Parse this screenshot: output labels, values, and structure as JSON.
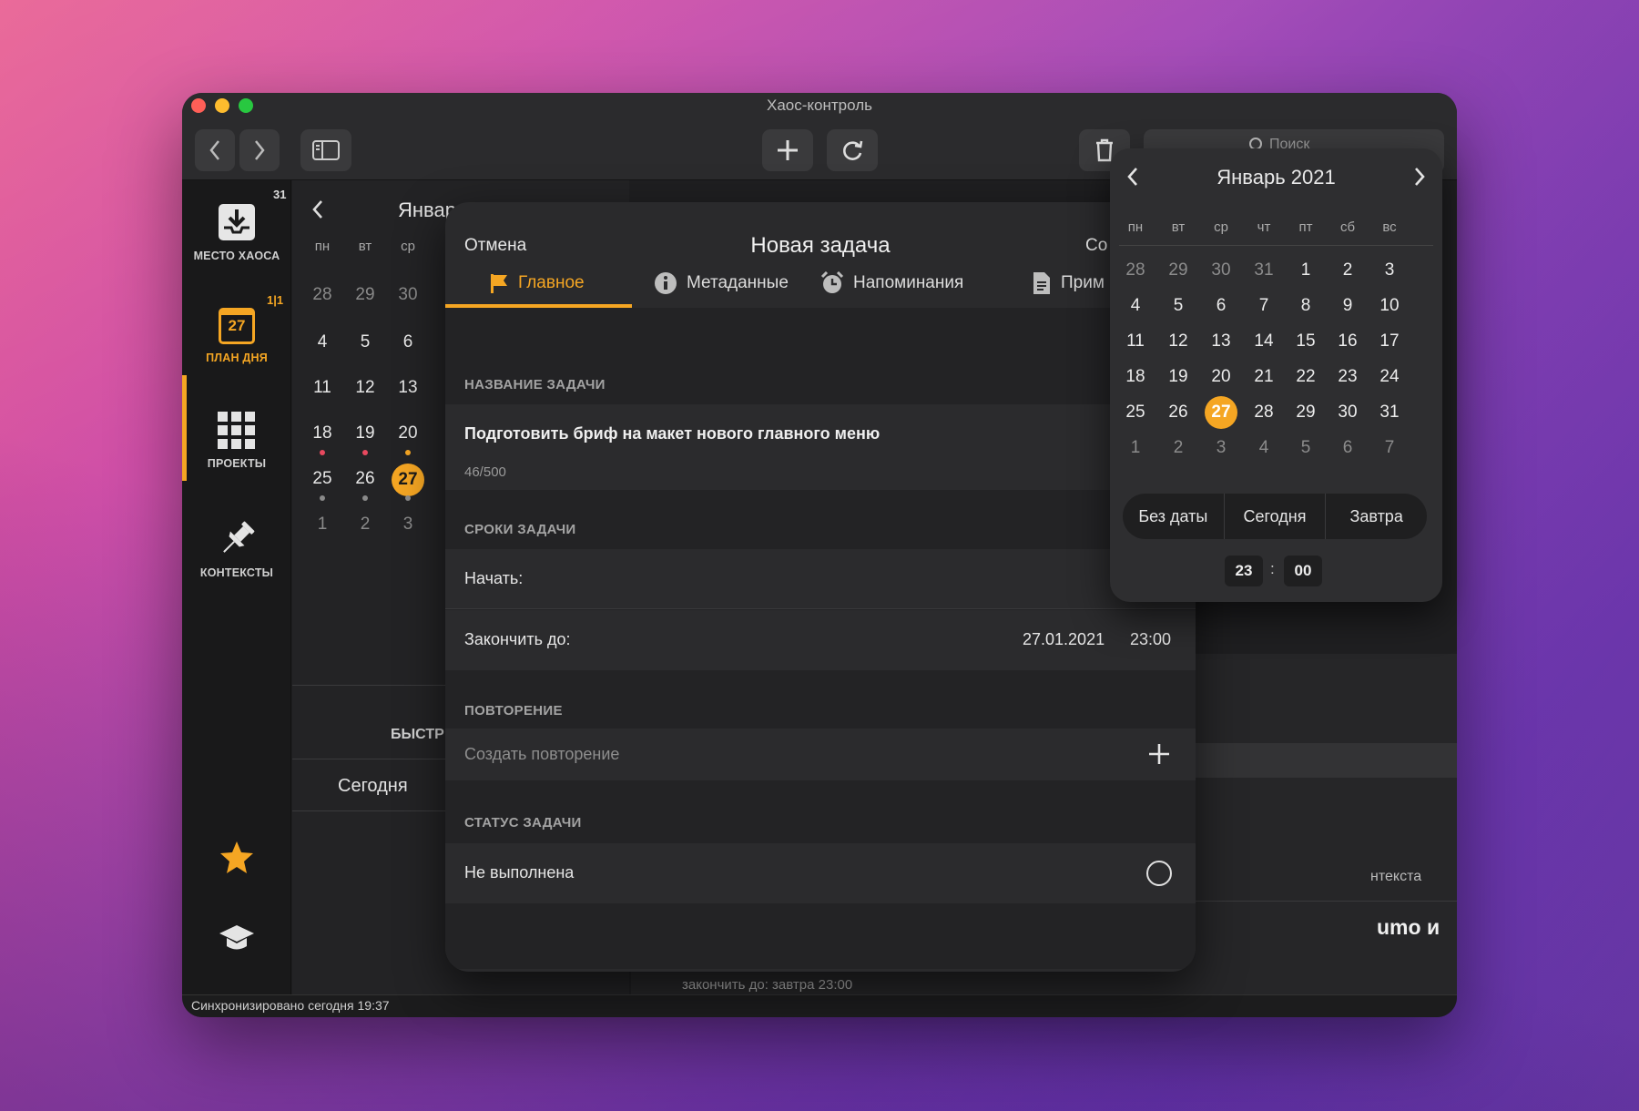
{
  "window": {
    "title": "Хаос-контроль",
    "status": "Синхронизировано сегодня 19:37"
  },
  "toolbar": {
    "search_placeholder": "Поиск"
  },
  "sidebar": {
    "inbox": {
      "label": "МЕСТО ХАОСА",
      "badge": "31"
    },
    "dayplan": {
      "label": "ПЛАН ДНЯ",
      "badge": "1|1",
      "icon_day": "27"
    },
    "projects": {
      "label": "ПРОЕКТЫ"
    },
    "contexts": {
      "label": "КОНТЕКСТЫ"
    }
  },
  "calendar_panel": {
    "month": "Январ",
    "weekdays": [
      "пн",
      "вт",
      "ср"
    ],
    "rows": [
      [
        "28",
        "29",
        "30"
      ],
      [
        "4",
        "5",
        "6"
      ],
      [
        "11",
        "12",
        "13"
      ],
      [
        "18",
        "19",
        "20"
      ],
      [
        "25",
        "26",
        "27"
      ],
      [
        "1",
        "2",
        "3"
      ]
    ],
    "quick_label": "БЫСТР",
    "today_button": "Сегодня"
  },
  "background_texts": {
    "contexts_hint": "нтекста",
    "title_fragment": "umo и",
    "deadline_hint": "закончить до: завтра 23:00"
  },
  "modal": {
    "cancel": "Отмена",
    "title": "Новая задача",
    "save": "Со",
    "tabs": [
      "Главное",
      "Метаданные",
      "Напоминания",
      "Прим"
    ],
    "name_section": "НАЗВАНИЕ ЗАДАЧИ",
    "task_name": "Подготовить бриф на макет нового главного меню",
    "char_count": "46/500",
    "deadline_section": "СРОКИ ЗАДАЧИ",
    "start_label": "Начать:",
    "end_label": "Закончить до:",
    "end_date": "27.01.2021",
    "end_time": "23:00",
    "repeat_section": "ПОВТОРЕНИЕ",
    "repeat_placeholder": "Создать повторение",
    "status_section": "СТАТУС ЗАДАЧИ",
    "status_value": "Не выполнена"
  },
  "datepicker": {
    "month": "Январь 2021",
    "weekdays": [
      "пн",
      "вт",
      "ср",
      "чт",
      "пт",
      "сб",
      "вс"
    ],
    "weeks": [
      [
        "28",
        "29",
        "30",
        "31",
        "1",
        "2",
        "3"
      ],
      [
        "4",
        "5",
        "6",
        "7",
        "8",
        "9",
        "10"
      ],
      [
        "11",
        "12",
        "13",
        "14",
        "15",
        "16",
        "17"
      ],
      [
        "18",
        "19",
        "20",
        "21",
        "22",
        "23",
        "24"
      ],
      [
        "25",
        "26",
        "27",
        "28",
        "29",
        "30",
        "31"
      ],
      [
        "1",
        "2",
        "3",
        "4",
        "5",
        "6",
        "7"
      ]
    ],
    "selected": "27",
    "quick": [
      "Без даты",
      "Сегодня",
      "Завтра"
    ],
    "hour": "23",
    "minute": "00",
    "separator": ":"
  },
  "colors": {
    "accent": "#f5a623",
    "dot_red": "#e8495f",
    "dot_grey": "#8a8a8a"
  }
}
